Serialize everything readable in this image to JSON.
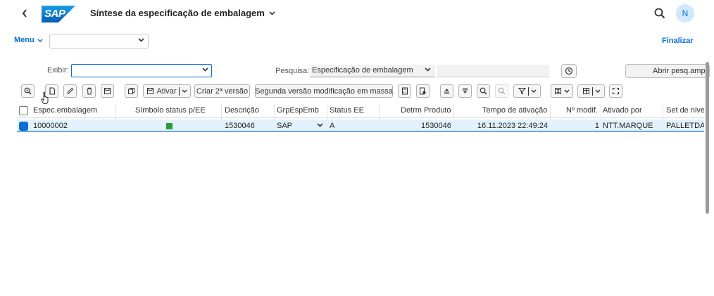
{
  "shell": {
    "logo_text": "SAP",
    "title": "Síntese da especificação de embalagem",
    "avatar_initial": "N"
  },
  "menubar": {
    "menu_label": "Menu",
    "finalize_label": "Finalizar"
  },
  "filter": {
    "show_label": "Exibir:",
    "show_value": "",
    "search_label": "Pesquisa:",
    "search_option": "Especificação de embalagem",
    "search_value": "",
    "advanced_search_label": "Abrir pesq.ampl"
  },
  "toolbar": {
    "activate_label": "Ativar",
    "create_second_version_label": "Criar 2ª versão",
    "second_version_mass_label": "Segunda versão modificação em massa"
  },
  "table": {
    "columns": [
      "Espec.embalagem",
      "Símbolo status p/EE",
      "Descrição",
      "GrpEspEmb",
      "Status EE",
      "Detrm Produto",
      "Tempo de ativação",
      "Nº modif.",
      "Ativado por",
      "Set de nive"
    ],
    "rows": [
      {
        "spec": "10000002",
        "status_symbol": "green",
        "description": "1530046",
        "group": "SAP",
        "status": "A",
        "product": "1530046",
        "activation_time": "16.11.2023 22:49:24",
        "change_no": "1",
        "activated_by": "NTT.MARQUE",
        "level_set": "PALLETDAT"
      }
    ]
  },
  "colors": {
    "accent": "#0a6ed1",
    "selected_row": "#e3f1fd",
    "status_green": "#2b9a3a"
  }
}
